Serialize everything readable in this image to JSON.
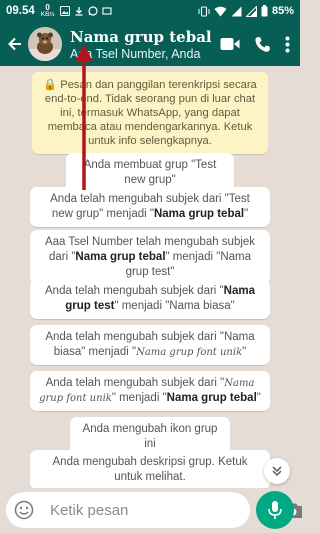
{
  "status_bar": {
    "time": "09.54",
    "net_speed_value": "0",
    "net_speed_unit": "KB/s",
    "battery": "85%"
  },
  "header": {
    "title": "Nama grup tebal",
    "subtitle": "Aaa Tsel Number, Anda",
    "back_icon": "arrow-left-icon",
    "video_icon": "video-call-icon",
    "call_icon": "phone-icon",
    "menu_icon": "more-vert-icon"
  },
  "notice": "🔒 Pesan dan panggilan terenkripsi secara end-to-end. Tidak seorang pun di luar chat ini, termasuk WhatsApp, yang dapat membaca atau mendengarkannya. Ketuk untuk info selengkapnya.",
  "messages": [
    {
      "parts": [
        [
          "Anda membuat grup \"Test new grup\"",
          ""
        ]
      ]
    },
    {
      "parts": [
        [
          "Anda telah mengubah subjek dari \"Test new grup\" menjadi \"",
          ""
        ],
        [
          "Nama grup tebal",
          "b"
        ],
        [
          "\"",
          ""
        ]
      ]
    },
    {
      "parts": [
        [
          "Aaa Tsel Number telah mengubah subjek dari \"",
          ""
        ],
        [
          "Nama grup tebal",
          "b"
        ],
        [
          "\" menjadi \"Nama grup test\"",
          ""
        ]
      ]
    },
    {
      "parts": [
        [
          "Anda telah mengubah subjek dari \"",
          ""
        ],
        [
          "Nama grup test",
          "b"
        ],
        [
          "\" menjadi \"Nama biasa\"",
          ""
        ]
      ]
    },
    {
      "parts": [
        [
          "Anda telah mengubah subjek dari \"Nama biasa\" menjadi \"",
          ""
        ],
        [
          "Nama grup font unik",
          "f"
        ],
        [
          "\"",
          ""
        ]
      ]
    },
    {
      "parts": [
        [
          "Anda telah mengubah subjek dari \"",
          ""
        ],
        [
          "Nama grup font unik",
          "f"
        ],
        [
          "\" menjadi \"",
          ""
        ],
        [
          "Nama grup tebal",
          "b"
        ],
        [
          "\"",
          ""
        ]
      ]
    },
    {
      "parts": [
        [
          "Anda mengubah ikon grup ini",
          ""
        ]
      ]
    },
    {
      "parts": [
        [
          "Anda mengubah deskripsi grup. Ketuk untuk melihat.",
          ""
        ]
      ]
    }
  ],
  "composer": {
    "placeholder": "Ketik pesan",
    "emoji_icon": "emoji-icon",
    "attach_icon": "paperclip-icon",
    "camera_icon": "camera-icon",
    "mic_icon": "microphone-icon"
  },
  "colors": {
    "header": "#075e54",
    "accent": "#00a884",
    "chat_bg": "#e5ddd5",
    "notice_bg": "#fdf4c5",
    "arrow": "#b3141b"
  }
}
